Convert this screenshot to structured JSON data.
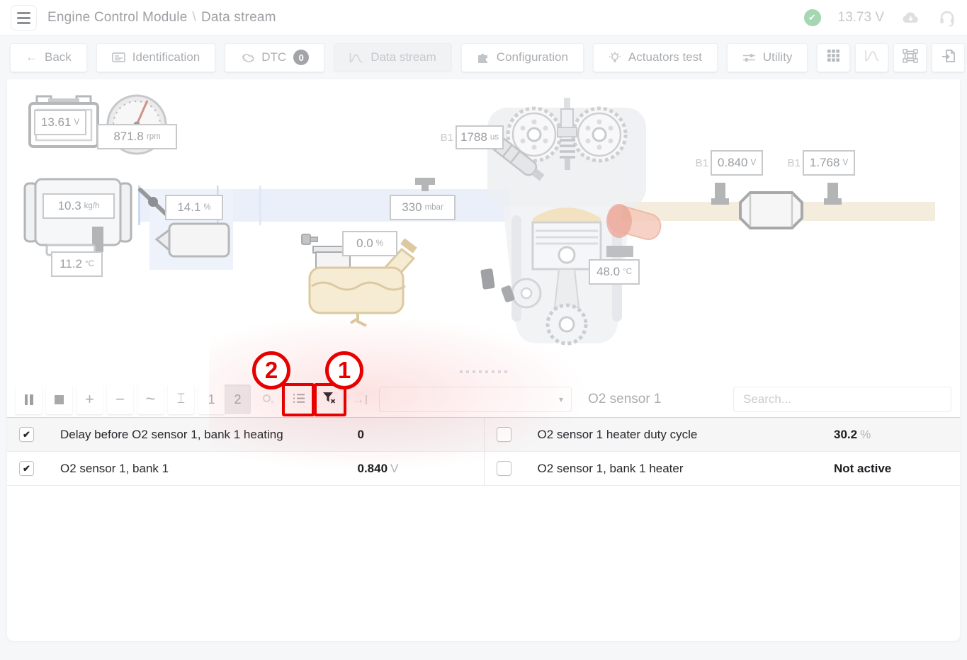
{
  "header": {
    "module": "Engine Control Module",
    "separator": "\\",
    "page": "Data stream",
    "voltage": "13.73 V"
  },
  "tabs": {
    "back": "Back",
    "identification": "Identification",
    "dtc": "DTC",
    "dtc_badge": "0",
    "data_stream": "Data stream",
    "configuration": "Configuration",
    "actuators_test": "Actuators test",
    "utility": "Utility"
  },
  "diagram": {
    "callouts": {
      "battery_voltage": {
        "value": "13.61",
        "unit": "V"
      },
      "engine_rpm": {
        "value": "871.8",
        "unit": "rpm"
      },
      "air_flow": {
        "value": "10.3",
        "unit": "kg/h"
      },
      "intake_air_temp": {
        "value": "11.2",
        "unit": "°C"
      },
      "throttle_position": {
        "value": "14.1",
        "unit": "%"
      },
      "manifold_pressure": {
        "value": "330",
        "unit": "mbar"
      },
      "purge_valve": {
        "value": "0.0",
        "unit": "%"
      },
      "injection_time": {
        "bank": "B1",
        "value": "1788",
        "unit": "us"
      },
      "coolant_temp": {
        "value": "48.0",
        "unit": "°C"
      },
      "o2_upstream": {
        "bank": "B1",
        "value": "0.840",
        "unit": "V"
      },
      "o2_downstream": {
        "bank": "B1",
        "value": "1.768",
        "unit": "V"
      }
    }
  },
  "stream_toolbar": {
    "page_buttons": {
      "one": "1",
      "two": "2"
    },
    "group_label": "O2 sensor 1",
    "search_placeholder": "Search..."
  },
  "stream_table": {
    "left_rows": [
      {
        "label": "Delay before O2 sensor 1, bank 1 heating",
        "value": "0",
        "unit": "",
        "checked": true
      },
      {
        "label": "O2 sensor 1, bank 1",
        "value": "0.840",
        "unit": "V",
        "checked": true
      }
    ],
    "right_rows": [
      {
        "label": "O2 sensor 1 heater duty cycle",
        "value": "30.2",
        "unit": "%",
        "checked": false
      },
      {
        "label": "O2 sensor 1, bank 1 heater",
        "value": "Not active",
        "unit": "",
        "checked": false
      }
    ]
  },
  "annotations": {
    "step_1": "1",
    "step_2": "2"
  },
  "icons": {
    "back_arrow": "←",
    "caret_down": "▾",
    "plus": "+",
    "minus": "−",
    "wave": "~",
    "text_height": "⌶",
    "arrow_right": "→",
    "check": "✔"
  },
  "colors": {
    "annotation_red": "#e60000",
    "status_green": "#a5d7b2"
  }
}
